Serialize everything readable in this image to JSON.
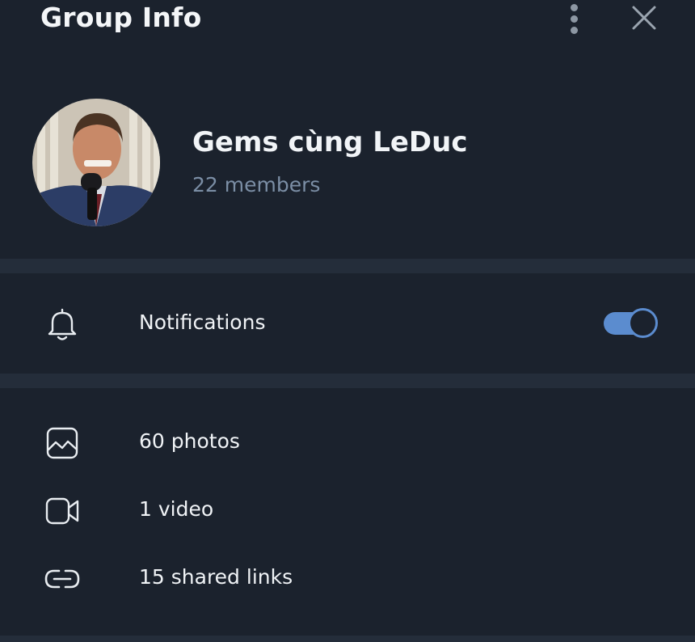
{
  "header": {
    "title": "Group Info",
    "menu_icon": "more-vertical-icon",
    "close_icon": "close-icon"
  },
  "group": {
    "name": "Gems cùng LeDuc",
    "members": "22 members"
  },
  "notifications": {
    "label": "Notifications",
    "enabled": true,
    "icon": "bell-icon"
  },
  "media": [
    {
      "label": "60 photos",
      "icon": "photo-icon"
    },
    {
      "label": "1 video",
      "icon": "video-icon"
    },
    {
      "label": "15 shared links",
      "icon": "link-icon"
    }
  ],
  "colors": {
    "background": "#1b222d",
    "separator": "#242d3a",
    "accent": "#5b8ccf",
    "muted": "#7b8ea5"
  }
}
